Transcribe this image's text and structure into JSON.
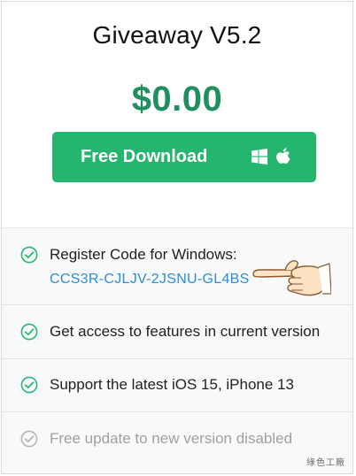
{
  "product": {
    "title": "Giveaway V5.2",
    "price": "$0.00"
  },
  "download_button": {
    "label": "Free Download",
    "icons": [
      "windows-icon",
      "apple-icon"
    ],
    "color": "#24b56f"
  },
  "features": [
    {
      "text": "Register Code for Windows:",
      "code": "CCS3R-CJLJV-2JSNU-GL4BS",
      "enabled": true
    },
    {
      "text": "Get access to features in current version",
      "enabled": true
    },
    {
      "text": "Support the latest iOS 15, iPhone 13",
      "enabled": true
    },
    {
      "text": "Free update to new version disabled",
      "enabled": false
    }
  ],
  "colors": {
    "accent_green": "#24b56f",
    "price_green": "#1f8f5f",
    "code_blue": "#2a8fd6",
    "check_green": "#2bb673",
    "disabled_gray": "#a0a0a0"
  },
  "watermark": "綠色工廠"
}
